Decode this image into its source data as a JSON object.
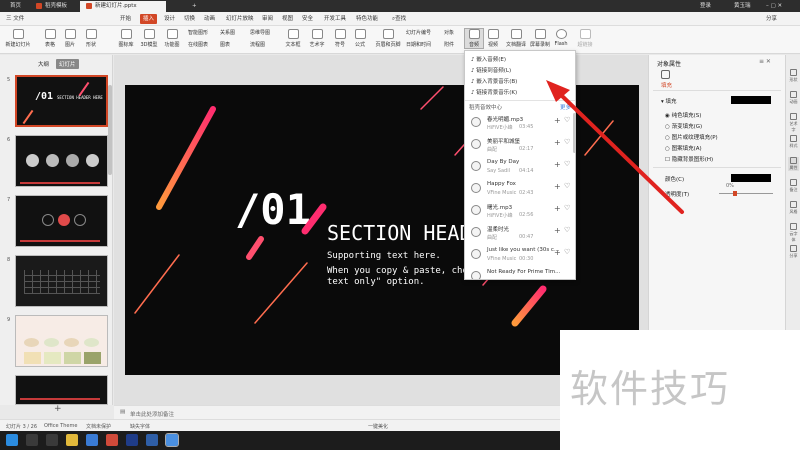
{
  "titlebar": {
    "tabs": [
      "首页",
      "稻壳模板",
      "新建幻灯片.pptx"
    ],
    "login": "登录",
    "user": "黄玉瑞"
  },
  "menubar": {
    "file": "三 文件",
    "items": [
      "开始",
      "插入",
      "设计",
      "切换",
      "动画",
      "幻灯片放映",
      "审阅",
      "视图",
      "安全",
      "开发工具",
      "特色功能"
    ],
    "search": "查找",
    "share": "分享",
    "active_index": 1
  },
  "ribbon": {
    "large": [
      "新建幻灯片",
      "表格",
      "图片",
      "形状",
      "图标库",
      "3D模型",
      "功能图",
      "音频",
      "视频",
      "文档翻译",
      "屏幕录制",
      "Flash",
      "超链接"
    ],
    "small": [
      "智能图形",
      "在线图表",
      "关系图",
      "图表",
      "思维导图",
      "流程图",
      "文本框",
      "艺术字",
      "符号",
      "公式",
      "页眉和页脚",
      "幻灯片编号",
      "对象",
      "日期和时间",
      "附件"
    ]
  },
  "leftpanel": {
    "tabs": [
      "大纲",
      "幻灯片"
    ],
    "slide_numbers": [
      "5",
      "6",
      "7",
      "8",
      "9"
    ],
    "add_symbol": "+"
  },
  "slide": {
    "number": "/01",
    "heading": "SECTION HEAD",
    "line1": "Supporting text here.",
    "line2": "When you copy & paste, choose",
    "line3": "text only\" option."
  },
  "thumb1": {
    "number": "/01",
    "title": "SECTION HEADER HERE"
  },
  "dropdown": {
    "items": [
      "嵌入音频(E)",
      "链接到音频(L)",
      "嵌入背景音乐(B)",
      "链接背景音乐(K)"
    ],
    "section": "稻壳音效中心",
    "more": "更多",
    "songs": [
      {
        "title": "春光明媚.mp3",
        "artist": "HiFiVE小峰",
        "dur": "03:45"
      },
      {
        "title": "美丽平和城堡",
        "artist": "曲配",
        "dur": "02:17"
      },
      {
        "title": "Day By Day",
        "artist": "Say Sadil",
        "dur": "04:14"
      },
      {
        "title": "Happy Fox",
        "artist": "VFine Music",
        "dur": "02:43"
      },
      {
        "title": "曙光.mp3",
        "artist": "HiFiVE小峰",
        "dur": "02:56"
      },
      {
        "title": "温柔时光",
        "artist": "曲配",
        "dur": "00:47"
      },
      {
        "title": "Just like you want (30s c...",
        "artist": "VFine Music",
        "dur": "00:30"
      },
      {
        "title": "Not Ready For Prime Tim...",
        "artist": "",
        "dur": ""
      }
    ],
    "add_icon": "+",
    "heart_icon": "♡"
  },
  "rightpane": {
    "title": "对象属性",
    "tab": "填充",
    "section": "填充",
    "options": [
      "纯色填充(S)",
      "渐变填充(G)",
      "图片或纹理填充(P)",
      "图案填充(A)",
      "隐藏背景图形(H)"
    ],
    "color_label": "颜色(C)",
    "transparency_label": "透明度(T)",
    "transparency_value": "0%",
    "side": [
      "形状",
      "动画",
      "艺术字",
      "样式",
      "属性",
      "备注",
      "风格",
      "云字体",
      "分享"
    ]
  },
  "notesbar": {
    "placeholder": "单击此处添加备注"
  },
  "statusbar": {
    "slide_info": "幻灯片 3 / 26",
    "theme": "Office Theme",
    "protect": "文档未保护",
    "fonts": "缺失字体",
    "beautify": "一键美化"
  },
  "watermark": "软件技巧",
  "colors": {
    "accent": "#d24726",
    "slide_bg": "#0a0a0a",
    "gradient_from": "#ff2d6f",
    "gradient_to": "#ff9a3c",
    "arrow": "#e0231f"
  }
}
